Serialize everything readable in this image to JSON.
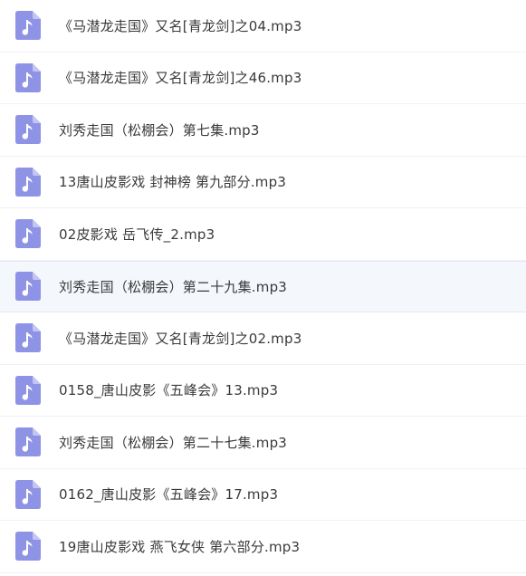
{
  "files": [
    {
      "name": "《马潜龙走国》又名[青龙剑]之04.mp3",
      "icon": "music-file-icon",
      "selected": false
    },
    {
      "name": "《马潜龙走国》又名[青龙剑]之46.mp3",
      "icon": "music-file-icon",
      "selected": false
    },
    {
      "name": "刘秀走国（松棚会）第七集.mp3",
      "icon": "music-file-icon",
      "selected": false
    },
    {
      "name": "13唐山皮影戏 封神榜 第九部分.mp3",
      "icon": "music-file-icon",
      "selected": false
    },
    {
      "name": "02皮影戏 岳飞传_2.mp3",
      "icon": "music-file-icon",
      "selected": false
    },
    {
      "name": "刘秀走国（松棚会）第二十九集.mp3",
      "icon": "music-file-icon",
      "selected": true
    },
    {
      "name": "《马潜龙走国》又名[青龙剑]之02.mp3",
      "icon": "music-file-icon",
      "selected": false
    },
    {
      "name": "0158_唐山皮影《五峰会》13.mp3",
      "icon": "music-file-icon",
      "selected": false
    },
    {
      "name": "刘秀走国（松棚会）第二十七集.mp3",
      "icon": "music-file-icon",
      "selected": false
    },
    {
      "name": "0162_唐山皮影《五峰会》17.mp3",
      "icon": "music-file-icon",
      "selected": false
    },
    {
      "name": "19唐山皮影戏 燕飞女侠 第六部分.mp3",
      "icon": "music-file-icon",
      "selected": false
    }
  ],
  "colors": {
    "icon_body": "#8f93e6",
    "icon_fold": "#c3c6f3",
    "icon_note": "#ffffff",
    "text": "#3a3a3a",
    "selected_bg": "#f4f7fc"
  }
}
